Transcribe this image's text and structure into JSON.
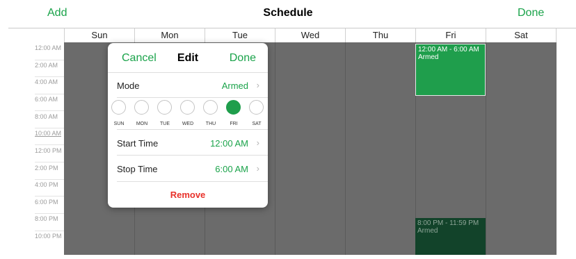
{
  "header": {
    "add_label": "Add",
    "title": "Schedule",
    "done_label": "Done"
  },
  "days": [
    "Sun",
    "Mon",
    "Tue",
    "Wed",
    "Thu",
    "Fri",
    "Sat"
  ],
  "times": [
    "12:00 AM",
    "2:00 AM",
    "4:00 AM",
    "6:00 AM",
    "8:00 AM",
    "10:00 AM",
    "12:00 PM",
    "2:00 PM",
    "4:00 PM",
    "6:00 PM",
    "8:00 PM",
    "10:00 PM"
  ],
  "events": [
    {
      "day": "Fri",
      "time": "12:00 AM - 6:00 AM",
      "mode": "Armed"
    },
    {
      "day": "Fri",
      "time": "8:00 PM - 11:59 PM",
      "mode": "Armed"
    }
  ],
  "edit_popup": {
    "cancel_label": "Cancel",
    "title": "Edit",
    "done_label": "Done",
    "mode_label": "Mode",
    "mode_value": "Armed",
    "weekdays": [
      "SUN",
      "MON",
      "TUE",
      "WED",
      "THU",
      "FRI",
      "SAT"
    ],
    "selected_day": "FRI",
    "start_label": "Start Time",
    "start_value": "12:00 AM",
    "stop_label": "Stop Time",
    "stop_value": "6:00 AM",
    "remove_label": "Remove"
  },
  "colors": {
    "accent": "#1aa34a",
    "event_fill": "#1f9e4c",
    "event_dark": "#12432a",
    "destructive": "#e8312a",
    "grid": "#6b6b6b"
  },
  "icons": {
    "chevron": "chevron-right-icon"
  }
}
